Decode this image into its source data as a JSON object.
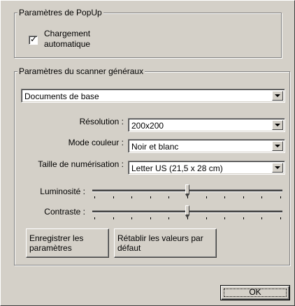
{
  "popup": {
    "legend": "Paramètres de PopUp",
    "auto_load": {
      "label_line1": "Chargement",
      "label_line2": "automatique",
      "checked": true,
      "mark": "✓"
    }
  },
  "scanner": {
    "legend": "Paramètres du scanner généraux",
    "profile": {
      "value": "Documents de base"
    },
    "resolution": {
      "label": "Résolution :",
      "value": "200x200"
    },
    "color_mode": {
      "label": "Mode couleur :",
      "value": "Noir et blanc"
    },
    "scan_size": {
      "label": "Taille de numérisation :",
      "value": "Letter US (21,5 x 28 cm)"
    },
    "brightness": {
      "label": "Luminosité :",
      "level": 0.5
    },
    "contrast": {
      "label": "Contraste :",
      "level": 0.5
    },
    "save_button": {
      "line1": "Enregistrer les",
      "line2": "paramètres"
    },
    "reset_button": {
      "line1": "Rétablir les valeurs par",
      "line2": "défaut"
    }
  },
  "ok_button": {
    "label": "OK"
  }
}
